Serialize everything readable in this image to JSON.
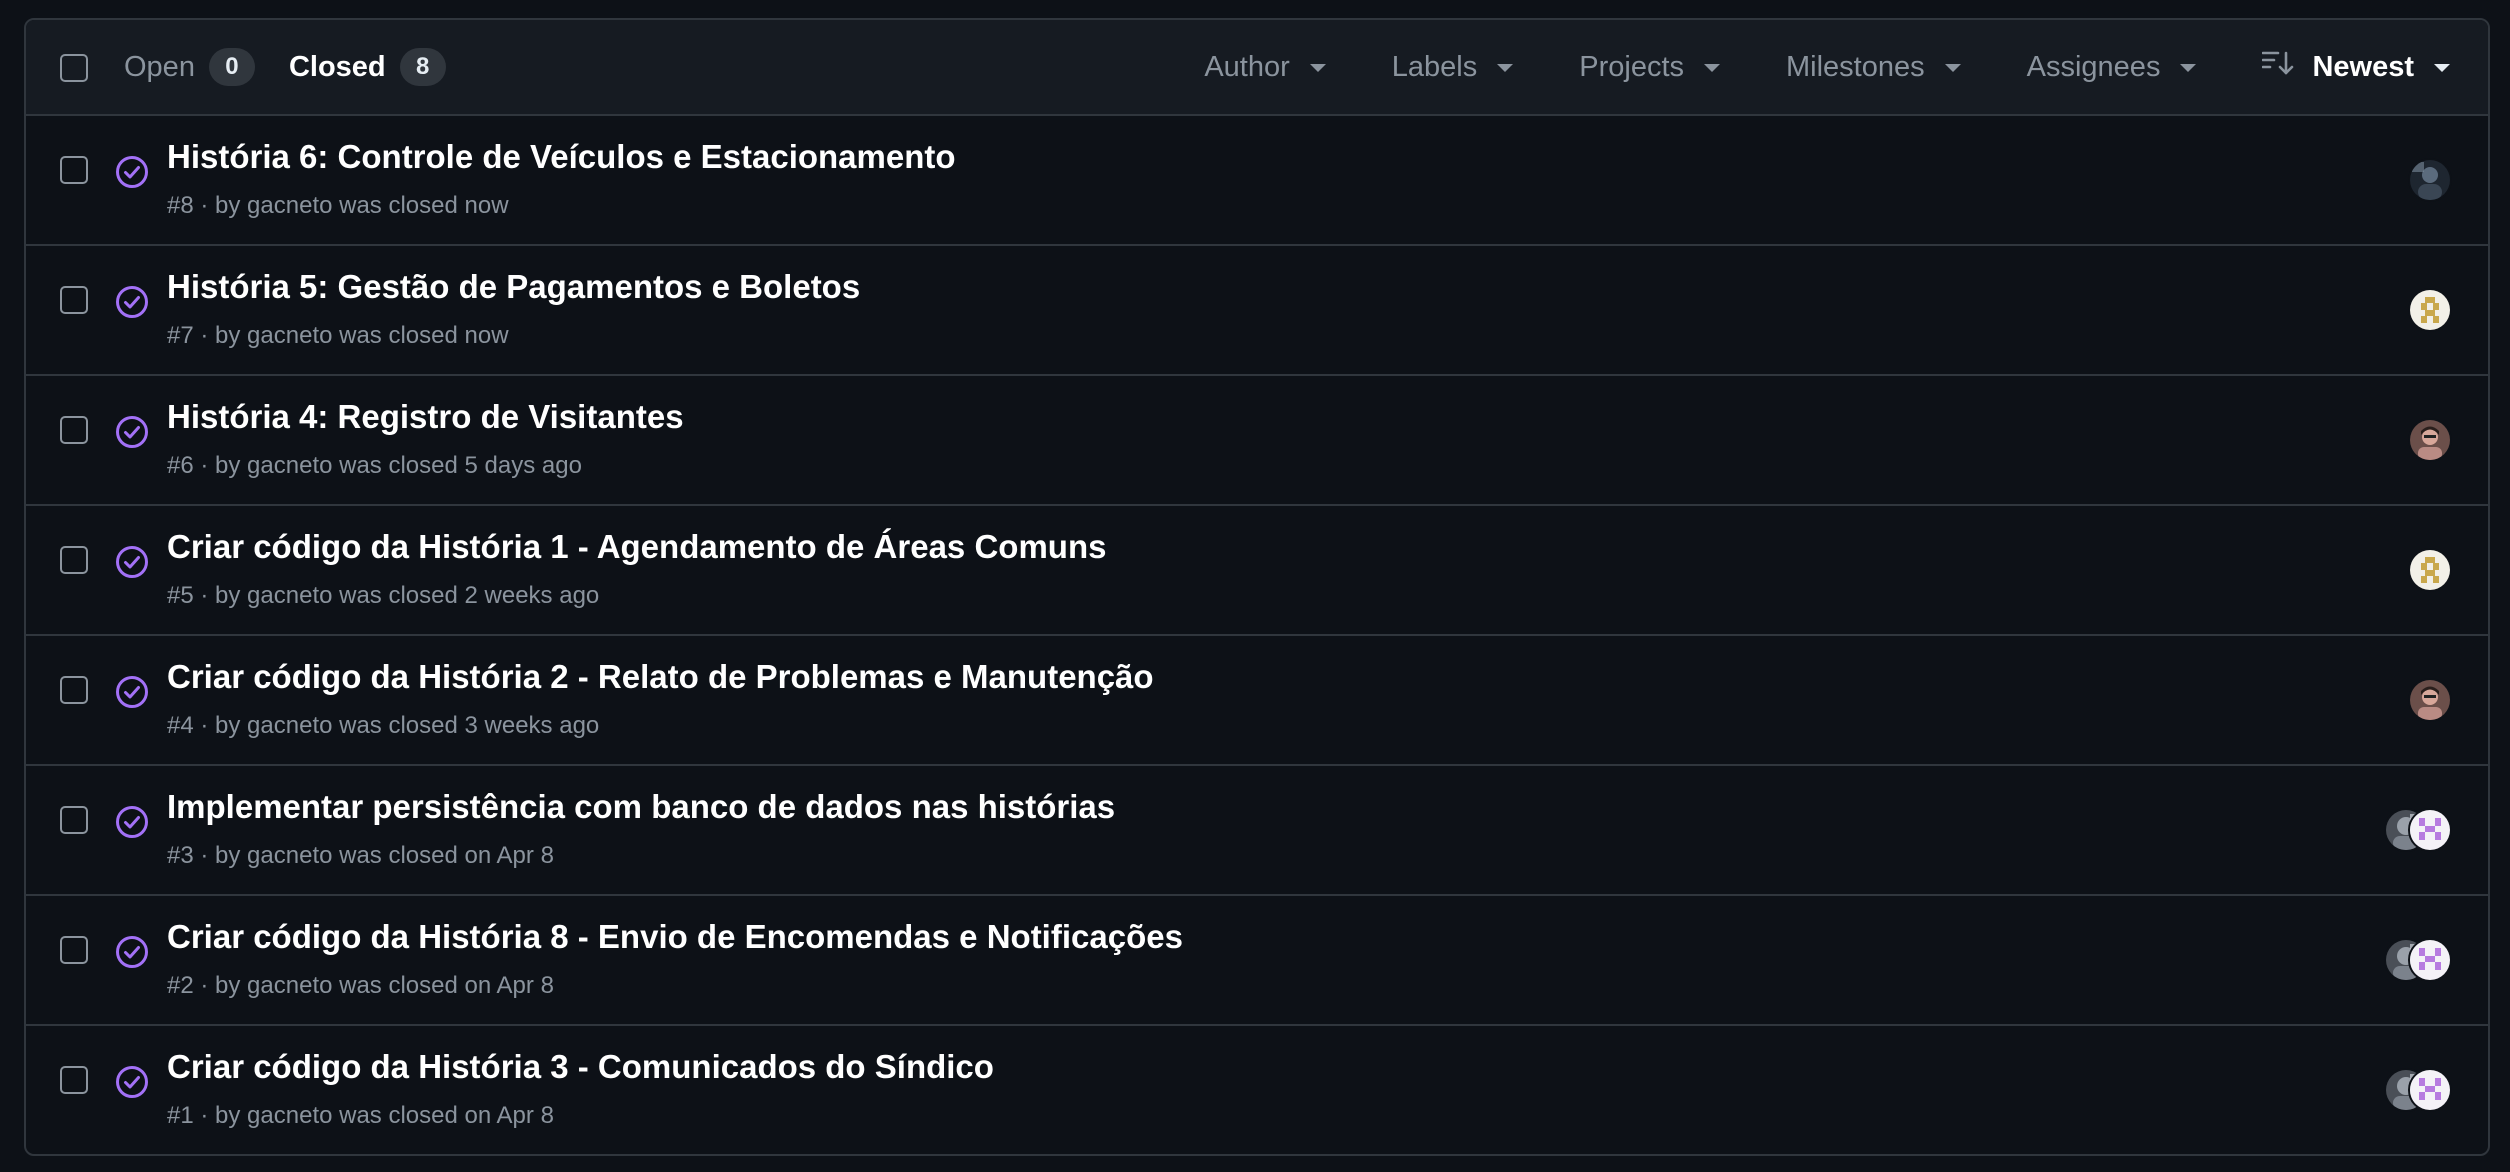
{
  "header": {
    "states": [
      {
        "label": "Open",
        "count": "0"
      },
      {
        "label": "Closed",
        "count": "8"
      }
    ],
    "filters": [
      {
        "label": "Author"
      },
      {
        "label": "Labels"
      },
      {
        "label": "Projects"
      },
      {
        "label": "Milestones"
      },
      {
        "label": "Assignees"
      }
    ],
    "sort_label": "Newest"
  },
  "colors": {
    "closed_icon": "#a371f7",
    "background": "#0d1117",
    "header_bg": "#161b22",
    "border": "#30363d",
    "muted_text": "#8b949e"
  },
  "issues": [
    {
      "title": "História 6: Controle de Veículos e Estacionamento",
      "number": "#8",
      "sep": " · by ",
      "author": "gacneto",
      "closed": " was closed now",
      "avatars": [
        "dark-photo-avatar"
      ]
    },
    {
      "title": "História 5: Gestão de Pagamentos e Boletos",
      "number": "#7",
      "sep": " · by ",
      "author": "gacneto",
      "closed": " was closed now",
      "avatars": [
        "identicon-gold-avatar"
      ]
    },
    {
      "title": "História 4: Registro de Visitantes",
      "number": "#6",
      "sep": " · by ",
      "author": "gacneto",
      "closed": " was closed 5 days ago",
      "avatars": [
        "person-photo-avatar"
      ]
    },
    {
      "title": "Criar código da História 1 - Agendamento de Áreas Comuns",
      "number": "#5",
      "sep": " · by ",
      "author": "gacneto",
      "closed": " was closed 2 weeks ago",
      "avatars": [
        "identicon-gold-avatar"
      ]
    },
    {
      "title": "Criar código da História 2 - Relato de Problemas e Manutenção",
      "number": "#4",
      "sep": " · by ",
      "author": "gacneto",
      "closed": " was closed 3 weeks ago",
      "avatars": [
        "person-photo-avatar"
      ]
    },
    {
      "title": "Implementar persistência com banco de dados nas histórias",
      "number": "#3",
      "sep": " · by ",
      "author": "gacneto",
      "closed": " was closed on Apr 8",
      "avatars": [
        "gray-photo-avatar",
        "identicon-purple-avatar"
      ]
    },
    {
      "title": "Criar código da História 8 - Envio de Encomendas e Notificações",
      "number": "#2",
      "sep": " · by ",
      "author": "gacneto",
      "closed": " was closed on Apr 8",
      "avatars": [
        "gray-photo-avatar",
        "identicon-purple-avatar"
      ]
    },
    {
      "title": "Criar código da História 3 - Comunicados do Síndico",
      "number": "#1",
      "sep": " · by ",
      "author": "gacneto",
      "closed": " was closed on Apr 8",
      "avatars": [
        "gray-photo-avatar",
        "identicon-purple-avatar"
      ]
    }
  ]
}
